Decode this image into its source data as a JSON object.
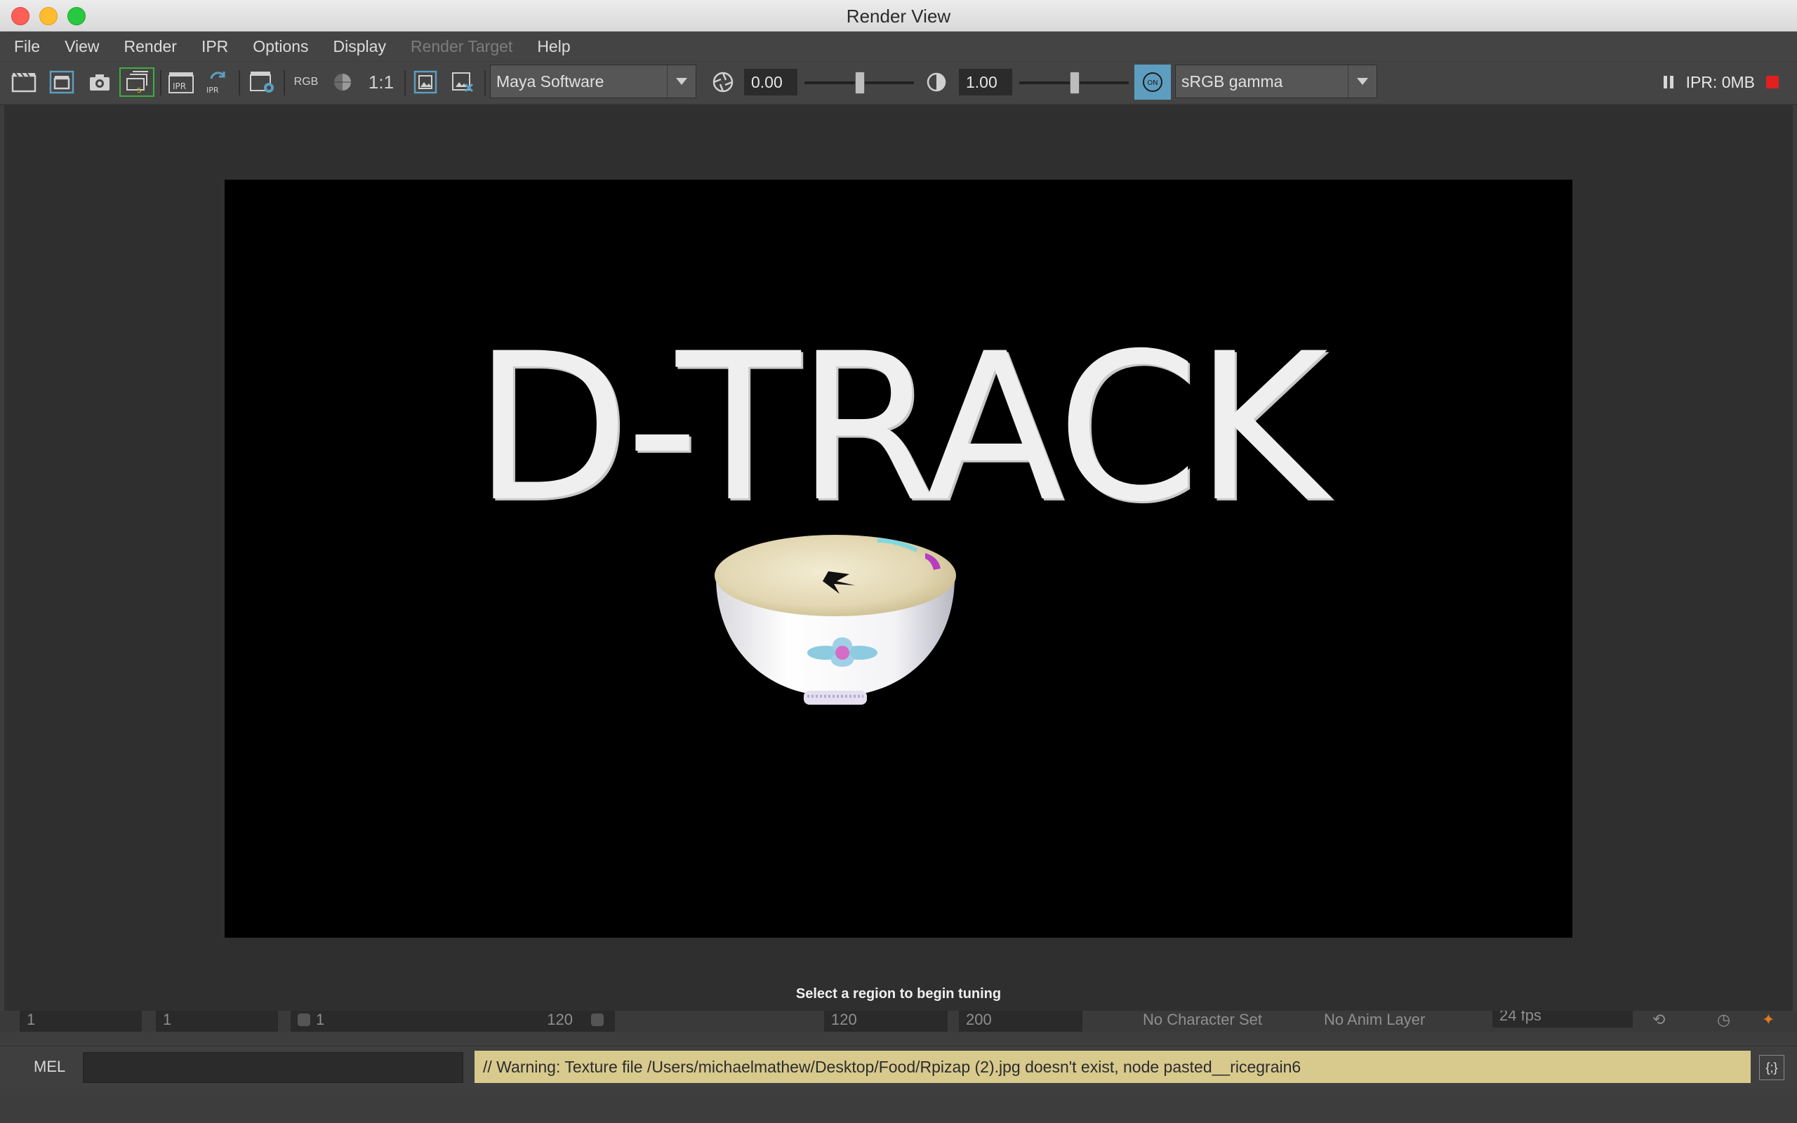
{
  "window": {
    "title": "Render View"
  },
  "menu": [
    "File",
    "View",
    "Render",
    "IPR",
    "Options",
    "Display",
    "Render Target",
    "Help"
  ],
  "toolbar": {
    "rgb_label": "RGB",
    "ratio_label": "1:1",
    "renderer": "Maya Software",
    "exposure": "0.00",
    "gamma": "1.00",
    "color_mgmt_toggle": "ON",
    "view_transform": "sRGB gamma",
    "ipr_memory": "IPR: 0MB",
    "icons": [
      "render-frame-icon",
      "render-region-icon",
      "snapshot-icon",
      "render-sequence-icon",
      "ipr-render-icon",
      "refresh-ipr-icon",
      "render-settings-icon",
      "rgb-channels-icon",
      "alpha-channel-icon",
      "real-size-icon",
      "keep-image-icon",
      "remove-image-icon",
      "exposure-icon",
      "gamma-icon",
      "pause-icon",
      "stop-icon"
    ]
  },
  "render": {
    "text": "D-TRACK",
    "status_message": "Select a region to begin tuning"
  },
  "time_range": {
    "start_frame": "1",
    "current_frame": "1",
    "range_start": "1",
    "range_end": "120",
    "playback_end": "120",
    "anim_end": "200",
    "character_set": "No Character Set",
    "anim_layer": "No Anim Layer",
    "fps": "24 fps"
  },
  "command_line": {
    "language": "MEL",
    "input_value": "",
    "result": "// Warning: Texture file /Users/michaelmathew/Desktop/Food/Rpizap (2).jpg doesn't exist, node pasted__ricegrain6"
  },
  "colors": {
    "accent": "#5d9ec0",
    "warning_bg": "#d8c98d",
    "stop": "#e02020"
  }
}
